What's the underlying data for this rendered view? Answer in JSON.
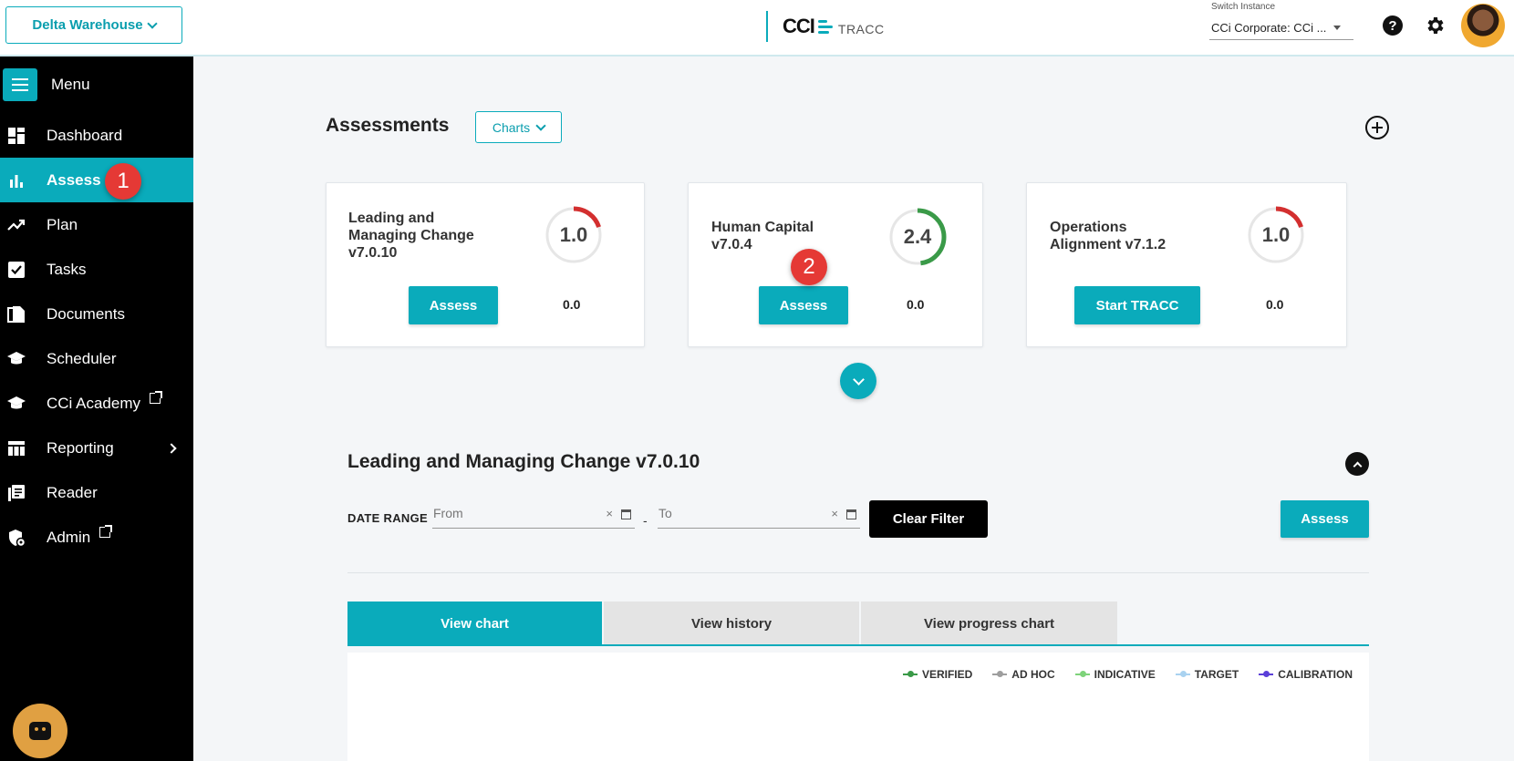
{
  "header": {
    "warehouse_label": "Delta Warehouse",
    "logo_cci": "CCI",
    "logo_tracc": "TRACC",
    "instance_label": "Switch Instance",
    "instance_value": "CCi Corporate: CCi ...",
    "help_glyph": "?"
  },
  "sidebar": {
    "menu_label": "Menu",
    "items": [
      {
        "label": "Dashboard",
        "icon": "dashboard-icon"
      },
      {
        "label": "Assess",
        "icon": "bar-chart-icon",
        "active": true
      },
      {
        "label": "Plan",
        "icon": "trending-up-icon"
      },
      {
        "label": "Tasks",
        "icon": "checkbox-icon"
      },
      {
        "label": "Documents",
        "icon": "documents-icon"
      },
      {
        "label": "Scheduler",
        "icon": "graduation-cap-icon"
      },
      {
        "label": "CCi Academy",
        "icon": "graduation-cap-icon",
        "external": true
      },
      {
        "label": "Reporting",
        "icon": "table-icon",
        "submenu": true
      },
      {
        "label": "Reader",
        "icon": "reader-icon"
      },
      {
        "label": "Admin",
        "icon": "admin-shield-icon",
        "external": true
      }
    ]
  },
  "badges": {
    "step1": "1",
    "step2": "2"
  },
  "main": {
    "title": "Assessments",
    "charts_label": "Charts",
    "cards": [
      {
        "title": "Leading and Managing Change v7.0.10",
        "score": "1.0",
        "score_fraction": 0.2,
        "gauge_color": "#d32f2f",
        "button": "Assess",
        "sub": "0.0"
      },
      {
        "title": "Human Capital v7.0.4",
        "score": "2.4",
        "score_fraction": 0.48,
        "gauge_color": "#3a9a48",
        "button": "Assess",
        "sub": "0.0"
      },
      {
        "title": "Operations Alignment v7.1.2",
        "score": "1.0",
        "score_fraction": 0.2,
        "gauge_color": "#d32f2f",
        "button": "Start TRACC",
        "sub": "0.0"
      }
    ],
    "section_title": "Leading and Managing Change v7.0.10",
    "date_range_label": "DATE RANGE",
    "from_placeholder": "From",
    "to_placeholder": "To",
    "dash": "-",
    "clear_x": "×",
    "clear_filter": "Clear Filter",
    "assess_label": "Assess",
    "tabs": [
      "View chart",
      "View history",
      "View progress chart"
    ],
    "legend": [
      {
        "label": "VERIFIED",
        "color": "#3a9a48"
      },
      {
        "label": "AD HOC",
        "color": "#9e9e9e"
      },
      {
        "label": "INDICATIVE",
        "color": "#7ed37a"
      },
      {
        "label": "TARGET",
        "color": "#a9d2f0"
      },
      {
        "label": "CALIBRATION",
        "color": "#5b3fd8"
      }
    ]
  }
}
